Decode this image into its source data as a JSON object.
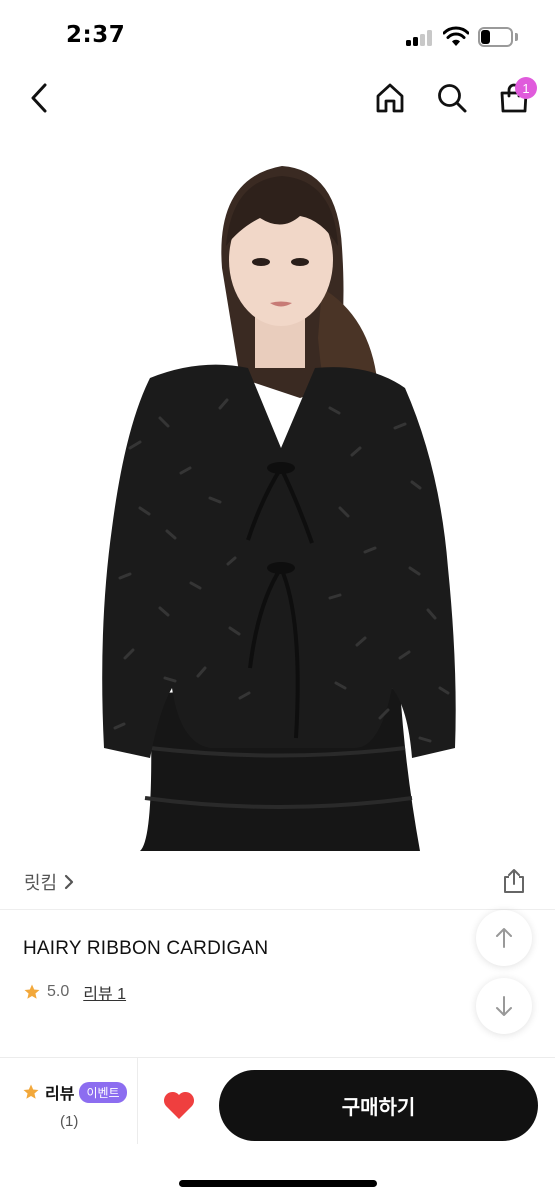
{
  "status_bar": {
    "time": "2:37",
    "icons": [
      "cellular-signal-icon",
      "wifi-icon",
      "battery-icon"
    ]
  },
  "top_nav": {
    "icons": [
      "back-chevron-icon",
      "home-icon",
      "search-icon",
      "shopping-bag-icon"
    ],
    "cart_count": "1",
    "badge_color": "#e05bdc"
  },
  "hero": {
    "image": "product-photo",
    "garment_color": "#1b1b1b"
  },
  "brand": {
    "name": "릿킴",
    "chevron": "chevron-right-icon",
    "share_icon": "share-icon"
  },
  "product": {
    "title": "HAIRY RIBBON CARDIGAN",
    "rating": "5.0",
    "review_link": "리뷰 1",
    "star_color": "#f2a83b"
  },
  "floating_controls": {
    "up_icon": "arrow-up-icon",
    "down_icon": "arrow-down-icon"
  },
  "bottom_bar": {
    "review_label": "리뷰",
    "event_badge": "이벤트",
    "review_count": "(1)",
    "like_icon": "heart-icon",
    "heart_color": "#ef3f3f",
    "buy_label": "구매하기"
  }
}
